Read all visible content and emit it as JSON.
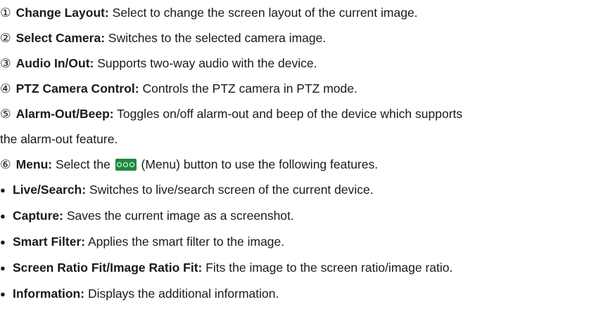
{
  "items": [
    {
      "marker": "①",
      "term": "Change Layout:",
      "desc": " Select to change the screen layout of the current image."
    },
    {
      "marker": "②",
      "term": "Select Camera:",
      "desc": " Switches to the selected camera image."
    },
    {
      "marker": "③",
      "term": "Audio In/Out:",
      "desc": " Supports two-way audio with the device."
    },
    {
      "marker": "④",
      "term": "PTZ Camera Control:",
      "desc": " Controls the PTZ camera in PTZ mode."
    },
    {
      "marker": "⑤",
      "term": "Alarm-Out/Beep:",
      "desc": " Toggles on/off alarm-out and beep of the device which supports",
      "desc_cont": "the alarm-out feature."
    },
    {
      "marker": "⑥",
      "term": "Menu:",
      "desc_before": " Select the ",
      "desc_after": " (Menu) button to use the following features."
    }
  ],
  "menu_button": {
    "icon": "three-dots-menu-icon",
    "color": "#1f8a3e"
  },
  "bullet": "●",
  "features": [
    {
      "term": "Live/Search:",
      "desc": " Switches to live/search screen of the current device."
    },
    {
      "term": "Capture:",
      "desc": " Saves the current image as a screenshot."
    },
    {
      "term": "Smart Filter:",
      "desc": " Applies the smart filter to the image."
    },
    {
      "term": "Screen Ratio Fit/Image Ratio Fit:",
      "desc": " Fits the image to the screen ratio/image ratio."
    },
    {
      "term": "Information:",
      "desc": " Displays the additional information."
    }
  ]
}
